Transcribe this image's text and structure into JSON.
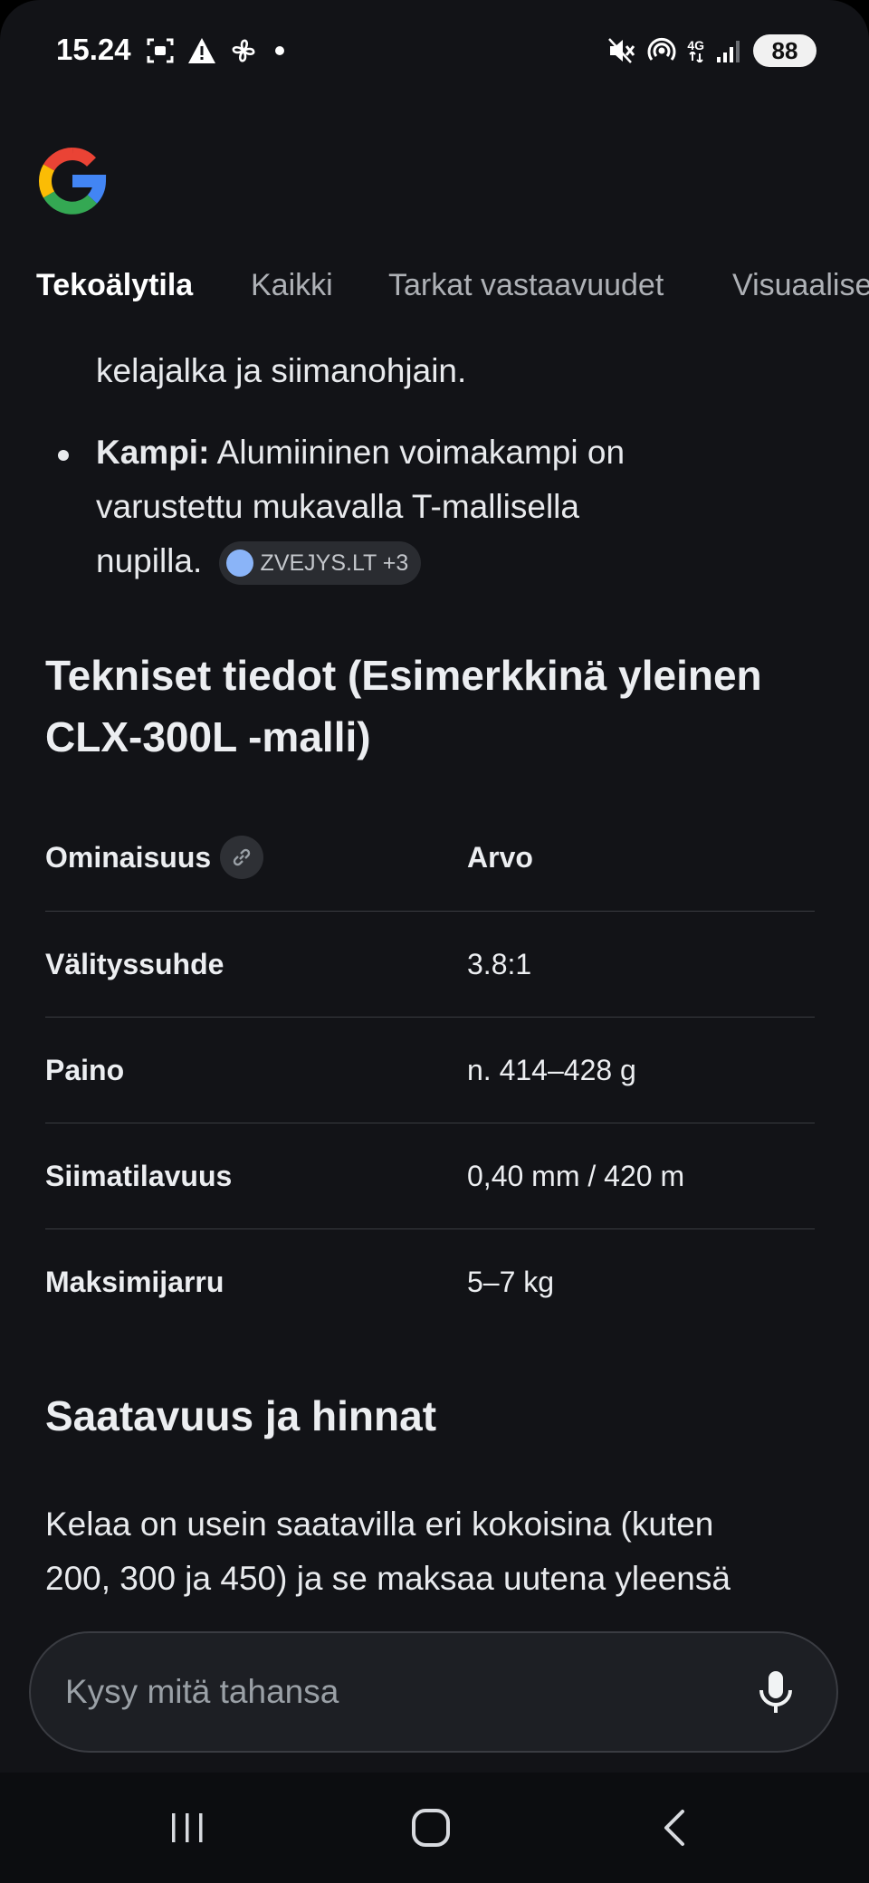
{
  "status_bar": {
    "time": "15.24",
    "battery": "88",
    "network": "4G"
  },
  "tabs": [
    {
      "label": "Tekoälytila",
      "active": true
    },
    {
      "label": "Kaikki",
      "active": false
    },
    {
      "label": "Tarkat vastaavuudet",
      "active": false
    },
    {
      "label": "Visuaalise",
      "active": false
    }
  ],
  "content": {
    "bullet_continuation": "kelajalka ja siimanohjain.",
    "bullet_kampi": {
      "term": "Kampi:",
      "text_line1": " Alumiininen voimakampi on",
      "text_line2": "varustettu mukavalla T-mallisella",
      "text_line3": "nupilla.",
      "source_chip": "ZVEJYS.LT +3"
    },
    "section_specs_title_line1": "Tekniset tiedot (Esimerkkinä yleinen",
    "section_specs_title_line2": "CLX-300L -malli)",
    "table": {
      "header_label": "Ominaisuus",
      "header_value": "Arvo",
      "rows": [
        {
          "label": "Välityssuhde",
          "value": "3.8:1"
        },
        {
          "label": "Paino",
          "value": "n. 414–428 g"
        },
        {
          "label": "Siimatilavuus",
          "value": "0,40 mm / 420 m"
        },
        {
          "label": "Maksimijarru",
          "value": "5–7 kg"
        }
      ]
    },
    "section_availability_title": "Saatavuus ja hinnat",
    "paragraph_line1": "Kelaa on usein saatavilla eri kokoisina (kuten",
    "paragraph_line2": "200, 300 ja 450) ja se maksaa uutena yleensä"
  },
  "ask_bar": {
    "placeholder": "Kysy mitä tahansa"
  },
  "icons": {
    "mic": "microphone-icon",
    "home": "home-icon",
    "back": "back-icon",
    "recents": "recents-icon"
  },
  "colors": {
    "background": "#121317",
    "text": "#e8eaed",
    "muted": "#aeb1b6",
    "chip": "#2a2c31"
  }
}
